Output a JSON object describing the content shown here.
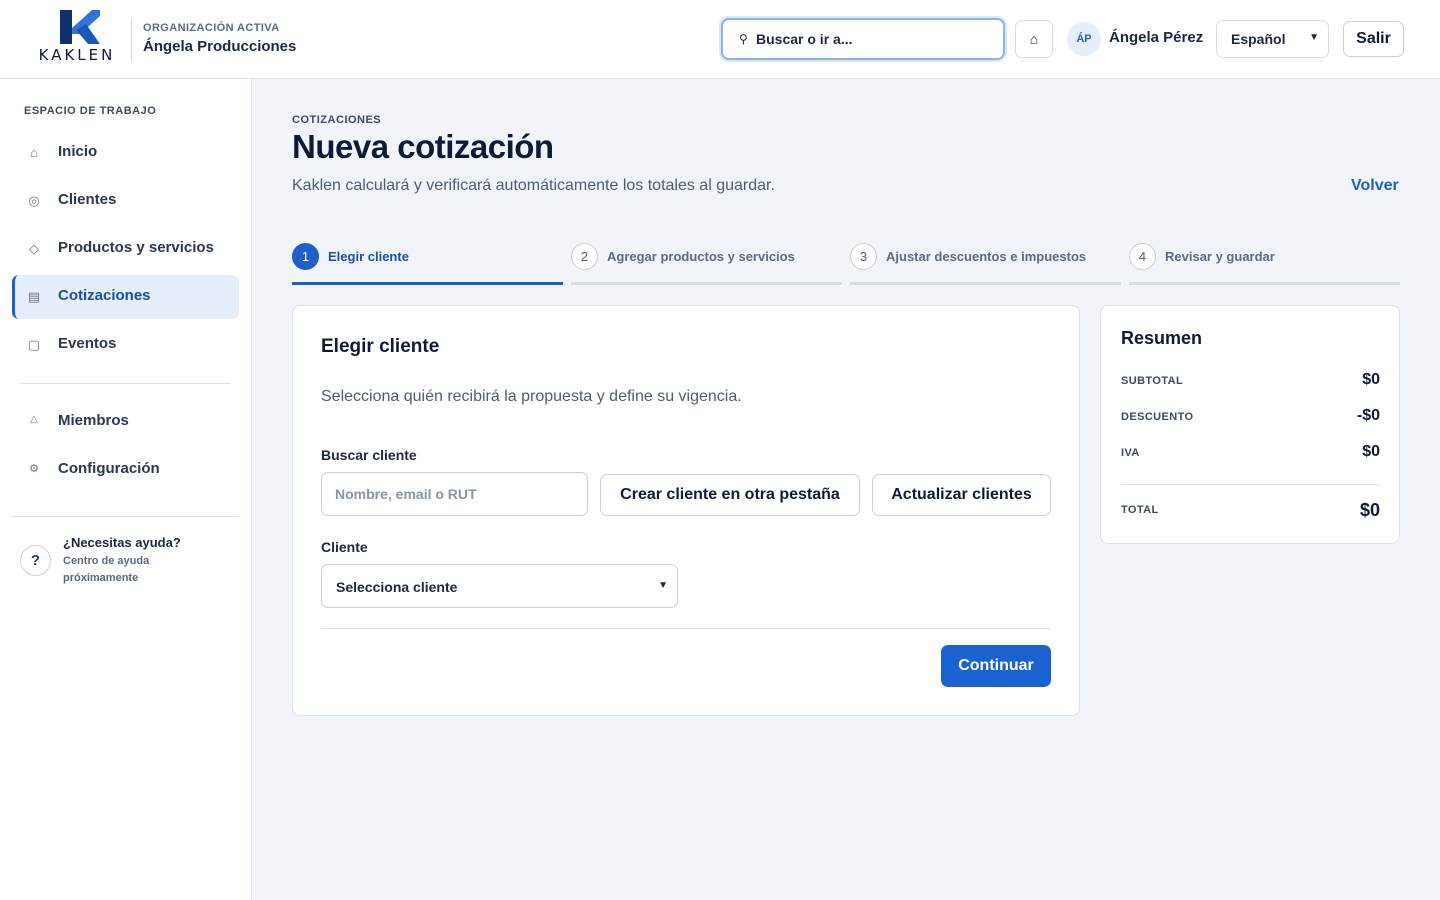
{
  "header": {
    "brand": "KAKLEN",
    "org_label": "ORGANIZACIÓN ACTIVA",
    "org_name": "Ángela Producciones",
    "search_label": "Buscar o ir a...",
    "avatar_initials": "ÁP",
    "user_name": "Ángela Pérez",
    "language": "Español",
    "logout_label": "Salir"
  },
  "sidebar": {
    "section_label": "ESPACIO DE TRABAJO",
    "items": [
      {
        "label": "Inicio",
        "icon": "home-icon"
      },
      {
        "label": "Clientes",
        "icon": "clients-icon"
      },
      {
        "label": "Productos y servicios",
        "icon": "products-icon"
      },
      {
        "label": "Cotizaciones",
        "icon": "quotes-icon",
        "active": true
      },
      {
        "label": "Eventos",
        "icon": "events-icon"
      },
      {
        "label": "Miembros",
        "icon": "members-icon"
      },
      {
        "label": "Configuración",
        "icon": "settings-icon"
      }
    ],
    "help": {
      "icon_glyph": "?",
      "title": "¿Necesitas ayuda?",
      "subtitle": "Centro de ayuda próximamente"
    }
  },
  "main": {
    "breadcrumb": "COTIZACIONES",
    "title": "Nueva cotización",
    "description": "Kaklen calculará y verificará automáticamente los totales al guardar.",
    "back_label": "Volver",
    "steps": [
      {
        "number": "1",
        "label": "Elegir cliente",
        "active": true
      },
      {
        "number": "2",
        "label": "Agregar productos y servicios"
      },
      {
        "number": "3",
        "label": "Ajustar descuentos e impuestos"
      },
      {
        "number": "4",
        "label": "Revisar y guardar"
      }
    ],
    "form": {
      "title": "Elegir cliente",
      "description": "Selecciona quién recibirá la propuesta y define su vigencia.",
      "search_label": "Buscar cliente",
      "search_placeholder": "Nombre, email o RUT",
      "search_value": "",
      "create_client_label": "Crear cliente en otra pestaña",
      "refresh_clients_label": "Actualizar clientes",
      "client_label": "Cliente",
      "client_selected": "Selecciona cliente",
      "continue_label": "Continuar"
    },
    "summary": {
      "title": "Resumen",
      "rows": [
        {
          "label": "SUBTOTAL",
          "value": "$0"
        },
        {
          "label": "DESCUENTO",
          "value": "-$0"
        },
        {
          "label": "IVA",
          "value": "$0"
        }
      ],
      "total_label": "TOTAL",
      "total_value": "$0"
    }
  },
  "colors": {
    "accent": "#1a62d0",
    "accent_text": "#1c4fa3",
    "background": "#f1f4f9",
    "sidebar_active_bg": "#e5eefb"
  }
}
